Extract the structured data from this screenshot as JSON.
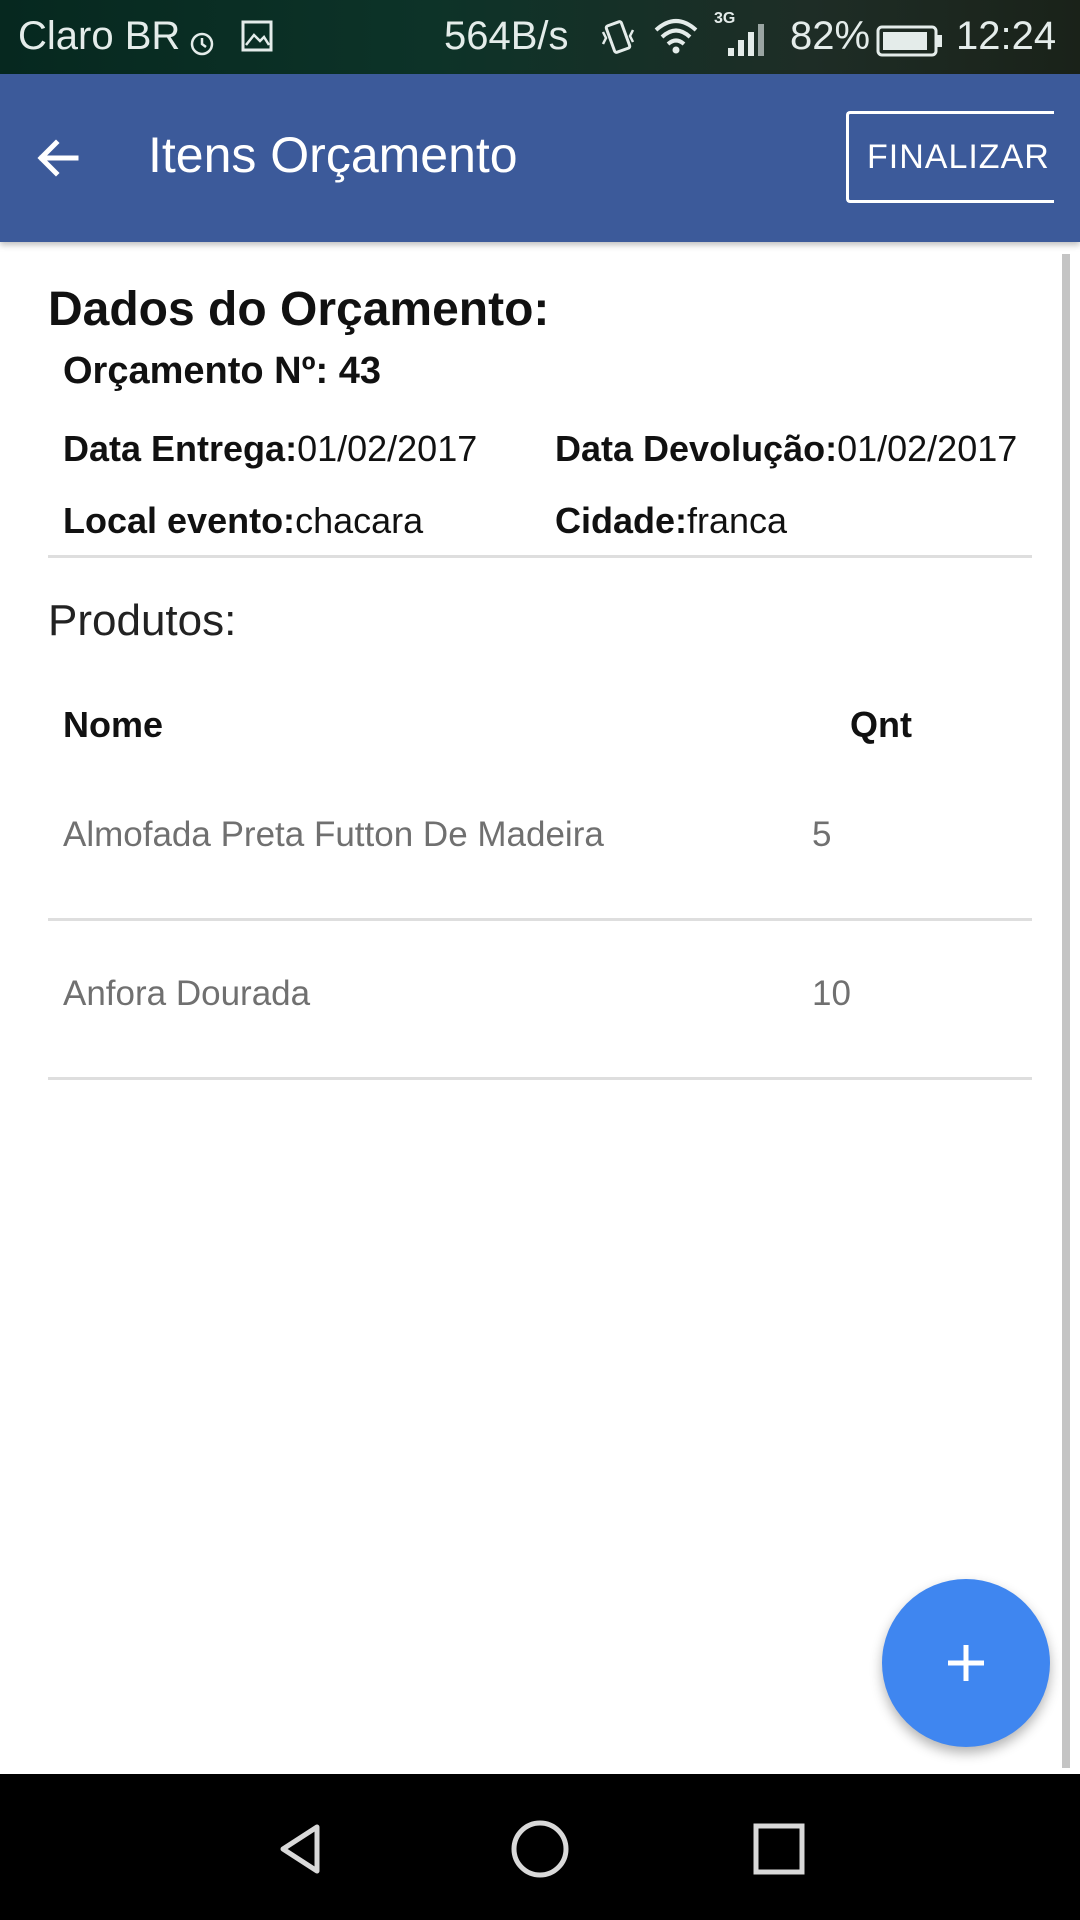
{
  "status_bar": {
    "carrier": "Claro BR",
    "net_speed": "564B/s",
    "network_type": "3G",
    "battery_percent": "82%",
    "time": "12:24",
    "icons": [
      "alarm-icon",
      "image-icon",
      "vibrate-icon",
      "wifi-icon",
      "signal-icon",
      "battery-icon"
    ]
  },
  "app_bar": {
    "title": "Itens Orçamento",
    "action_label": "FINALIZAR",
    "color": "#3c5a9a"
  },
  "budget": {
    "section_title": "Dados do Orçamento:",
    "number_text": "Orçamento Nº: 43",
    "delivery_label": "Data Entrega:",
    "delivery_value": "01/02/2017",
    "return_label": "Data Devolução:",
    "return_value": "01/02/2017",
    "event_label": "Local evento:",
    "event_value": "chacara",
    "city_label": "Cidade:",
    "city_value": "franca"
  },
  "products": {
    "title": "Produtos:",
    "col_name": "Nome",
    "col_qty": "Qnt",
    "rows": [
      {
        "name": "Almofada Preta Futton De Madeira",
        "qty": "5"
      },
      {
        "name": "Anfora Dourada",
        "qty": "10"
      }
    ]
  },
  "fab": {
    "icon": "plus-icon",
    "color": "#3f86f0"
  }
}
